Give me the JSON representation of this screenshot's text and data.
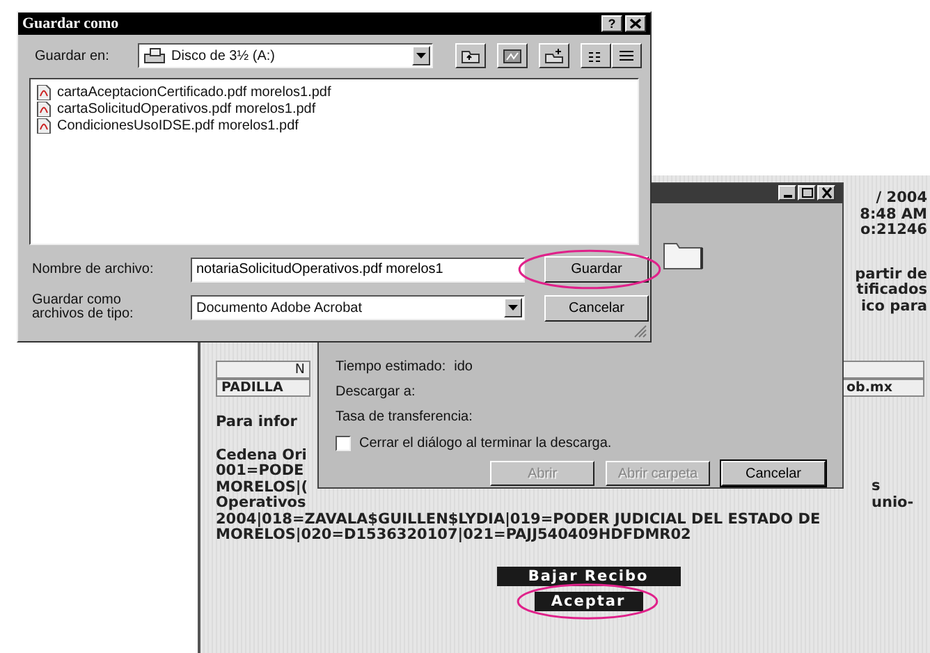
{
  "save_dialog": {
    "title": "Guardar como",
    "help": "?",
    "location_label": "Guardar en:",
    "location_value": "Disco de 3½ (A:)",
    "files": [
      "cartaAceptacionCertificado.pdf morelos1.pdf",
      "cartaSolicitudOperativos.pdf morelos1.pdf",
      "CondicionesUsoIDSE.pdf morelos1.pdf"
    ],
    "filename_label": "Nombre de archivo:",
    "filename_value": "notariaSolicitudOperativos.pdf morelos1",
    "type_label": "Guardar como archivos de tipo:",
    "type_value": "Documento Adobe Acrobat",
    "buttons": [
      {
        "label": "Guardar",
        "circled": true
      },
      {
        "label": "Cancelar",
        "circled": false
      }
    ]
  },
  "download_dialog": {
    "fields": [
      {
        "label": "Tiempo estimado:",
        "value": "ido"
      },
      {
        "label": "Descargar a:"
      },
      {
        "label": "Tasa de transferencia:"
      }
    ],
    "close_when_done": {
      "label": "Cerrar el diálogo al terminar la descarga.",
      "checked": false
    },
    "buttons": [
      {
        "label": "Abrir",
        "disabled": true
      },
      {
        "label": "Abrir carpeta",
        "disabled": true
      },
      {
        "label": "Cancelar",
        "disabled": false
      }
    ]
  },
  "page": {
    "top_right": [
      "/ 2004",
      "8:48 AM",
      "o:21246"
    ],
    "right_paragraph": [
      "partir de",
      "tificados",
      "ico para"
    ],
    "table": {
      "header_left": "N",
      "row_left": "PADILLA",
      "row_right": "ob.mx"
    },
    "left_lines": [
      "Para infor",
      "Cedena Ori",
      "001=PODE",
      "MORELOS|(",
      "Operativos"
    ],
    "right_lines": [
      "s",
      "unio-"
    ],
    "full_lines": [
      "2004|018=ZAVALA$GUILLEN$LYDIA|019=PODER JUDICIAL DEL ESTADO DE",
      "MORELOS|020=D1536320107|021=PAJJ540409HDFDMR02"
    ],
    "buttons": [
      {
        "label": "Bajar Recibo",
        "circled": false
      },
      {
        "label": "Aceptar",
        "circled": true
      }
    ]
  }
}
